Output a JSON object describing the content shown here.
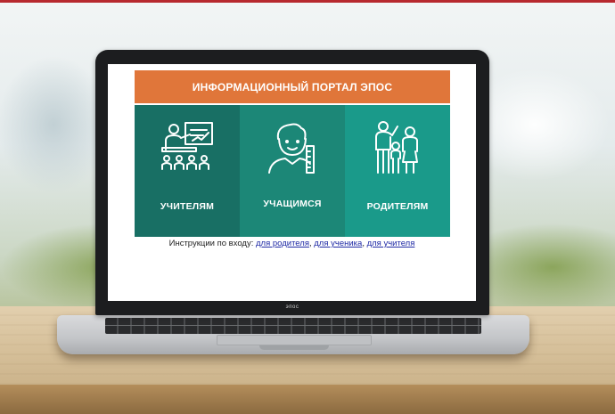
{
  "portal": {
    "header_title": "ИНФОРМАЦИОННЫЙ ПОРТАЛ ЭПОС",
    "tiles": [
      {
        "label": "УЧИТЕЛЯМ",
        "icon": "teacher-icon",
        "color": "#186f64"
      },
      {
        "label": "УЧАЩИМСЯ",
        "icon": "student-icon",
        "color": "#1c8777"
      },
      {
        "label": "РОДИТЕЛЯМ",
        "icon": "parents-icon",
        "color": "#1a9a8a"
      }
    ],
    "instructions": {
      "prefix": "Инструкции по входу:",
      "links": [
        {
          "text": "для родителя",
          "sep": ","
        },
        {
          "text": "для ученика",
          "sep": ","
        },
        {
          "text": "для учителя",
          "sep": ""
        }
      ]
    },
    "accent": "#e0763a"
  },
  "laptop": {
    "brand_text": "эпос"
  }
}
